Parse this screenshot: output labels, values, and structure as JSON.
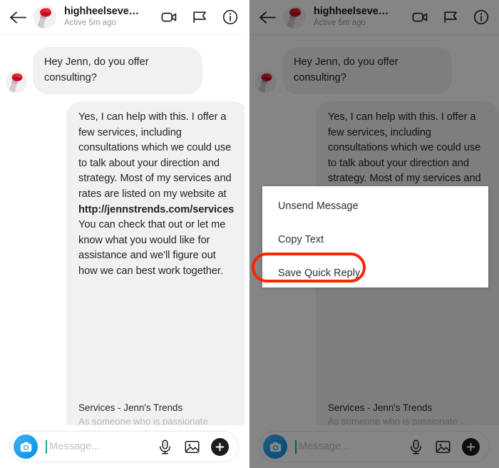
{
  "header": {
    "back_icon": "back-arrow-icon",
    "avatar_icon": "profile-avatar-rose",
    "username": "highheelseve…",
    "status": "Active 5m ago",
    "video_call_icon": "video-camera-icon",
    "flag_icon": "flag-icon",
    "info_icon": "info-circle-icon"
  },
  "thread": {
    "incoming_message": "Hey Jenn, do you offer consulting?",
    "outgoing_message": {
      "part1": "Yes, I can help with this. I offer a few services, including consultations which we could use to talk about your direction and strategy. Most of my services and rates are listed on my website at ",
      "link": "http://jennstrends.com/services",
      "part2": " You can check that out or let me know what you would like for assistance and we'll figure out how we can best work together."
    },
    "link_preview": {
      "title": "Services - Jenn's Trends",
      "description": "As someone who is passionate"
    }
  },
  "composer": {
    "camera_icon": "camera-icon",
    "placeholder": "Message...",
    "mic_icon": "microphone-icon",
    "gallery_icon": "image-gallery-icon",
    "plus_icon": "plus-icon"
  },
  "context_menu": {
    "items": [
      {
        "label": "Unsend Message",
        "highlighted": false
      },
      {
        "label": "Copy Text",
        "highlighted": false
      },
      {
        "label": "Save Quick Reply",
        "highlighted": true
      }
    ],
    "highlight_color": "#fa2600"
  },
  "colors": {
    "bubble_bg": "#f1f0f3",
    "text": "#232323",
    "muted": "#9a9a9a",
    "camera_blue": "#1f9ef0",
    "highlight_red": "#fa2600",
    "overlay": "rgba(0,0,0,0.48)"
  }
}
